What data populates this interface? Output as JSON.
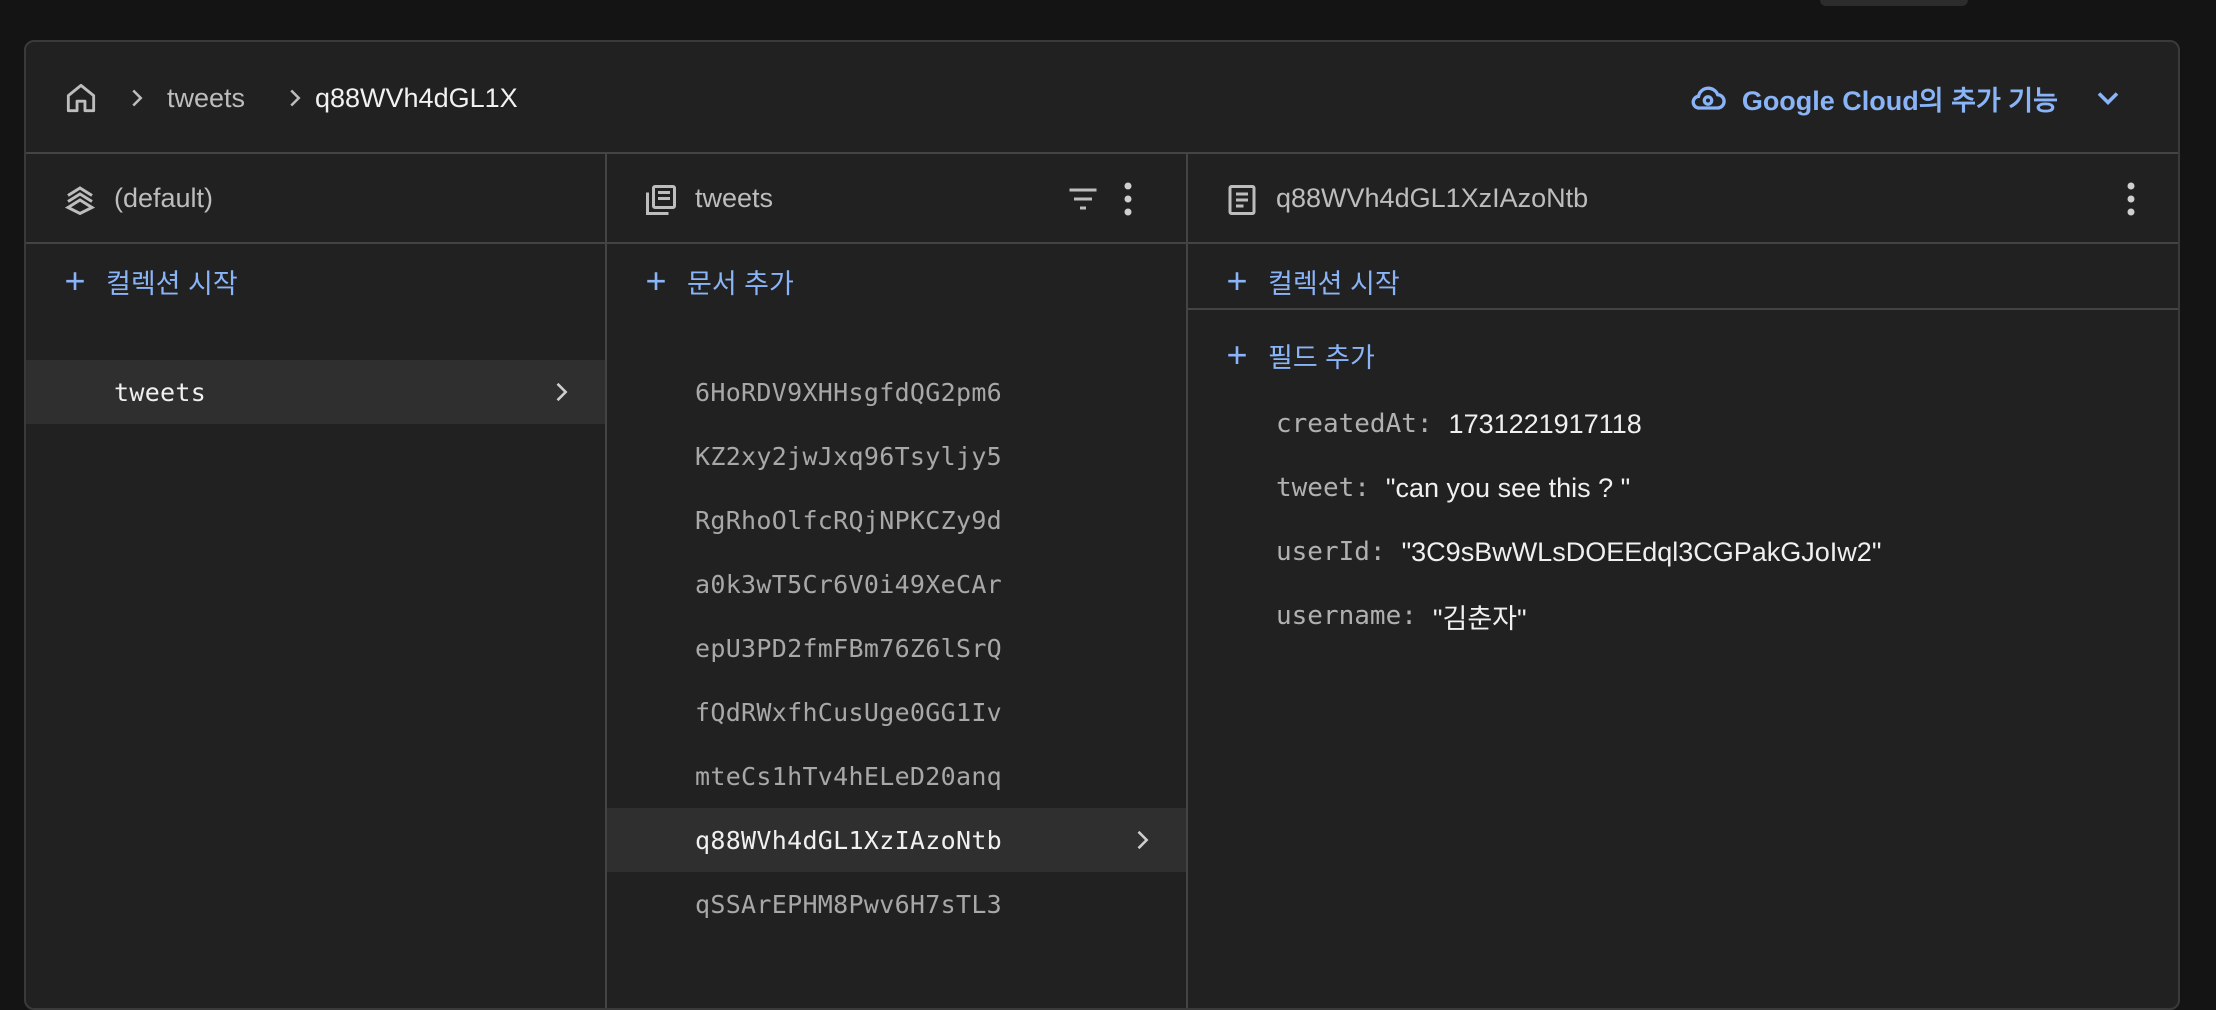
{
  "breadcrumb": {
    "home_icon": "home-icon",
    "items": [
      "tweets",
      "q88WVh4dGL1X"
    ]
  },
  "cloud": {
    "label": "Google Cloud의 추가 기능",
    "icon": "cloud-icon"
  },
  "columns": {
    "database": {
      "title": "(default)",
      "icon": "database-stack-icon",
      "action": "컬렉션 시작",
      "items": [
        {
          "label": "tweets",
          "selected": true
        }
      ]
    },
    "collection": {
      "title": "tweets",
      "icon": "collection-icon",
      "action": "문서 추가",
      "items": [
        {
          "label": "6HoRDV9XHHsgfdQG2pm6",
          "selected": false
        },
        {
          "label": "KZ2xy2jwJxq96Tsyljy5",
          "selected": false
        },
        {
          "label": "RgRhoOlfcRQjNPKCZy9d",
          "selected": false
        },
        {
          "label": "a0k3wT5Cr6V0i49XeCAr",
          "selected": false
        },
        {
          "label": "epU3PD2fmFBm76Z6lSrQ",
          "selected": false
        },
        {
          "label": "fQdRWxfhCusUge0GG1Iv",
          "selected": false
        },
        {
          "label": "mteCs1hTv4hELeD20anq",
          "selected": false
        },
        {
          "label": "q88WVh4dGL1XzIAzoNtb",
          "selected": true
        },
        {
          "label": "qSSArEPHM8Pwv6H7sTL3",
          "selected": false
        }
      ]
    },
    "document": {
      "title": "q88WVh4dGL1XzIAzoNtb",
      "icon": "document-icon",
      "action_collection": "컬렉션 시작",
      "action_field": "필드 추가",
      "fields": [
        {
          "key": "createdAt:",
          "value": "1731221917118"
        },
        {
          "key": "tweet:",
          "value": "\"can you see this ? \""
        },
        {
          "key": "userId:",
          "value": "\"3C9sBwWLsDOEEdql3CGPakGJoIw2\""
        },
        {
          "key": "username:",
          "value": "\"김춘자\""
        }
      ]
    }
  },
  "colors": {
    "accent": "#8ab4f8",
    "background": "#212121",
    "selected_row": "#2f2f2f"
  }
}
